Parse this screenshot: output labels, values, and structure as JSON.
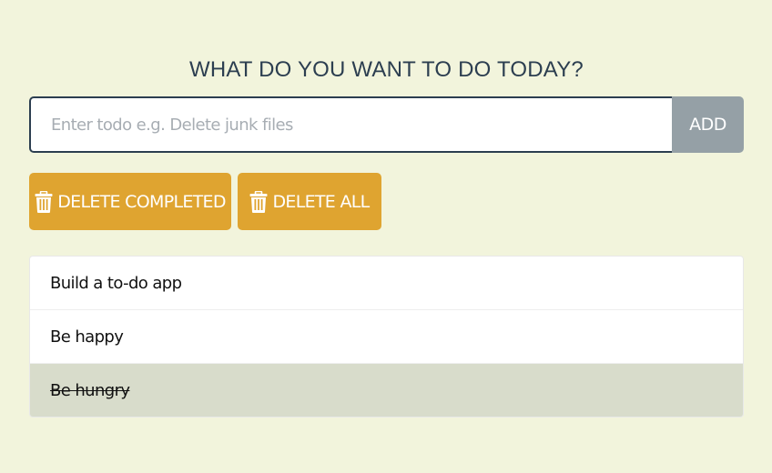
{
  "header": {
    "title": "WHAT DO YOU WANT TO DO TODAY?"
  },
  "input": {
    "placeholder": "Enter todo e.g. Delete junk files",
    "value": ""
  },
  "add_button": {
    "label": "ADD"
  },
  "actions": {
    "delete_completed_label": "DELETE COMPLETED",
    "delete_all_label": "DELETE ALL",
    "icon": "trash-icon"
  },
  "todos": [
    {
      "text": "Build a to-do app",
      "completed": false
    },
    {
      "text": "Be happy",
      "completed": false
    },
    {
      "text": "Be hungry",
      "completed": true
    }
  ],
  "colors": {
    "background": "#f2f4dc",
    "heading": "#2c3e50",
    "accent_button": "#dfa430",
    "add_button": "#95a0a6",
    "completed_row": "#d8dccb"
  }
}
